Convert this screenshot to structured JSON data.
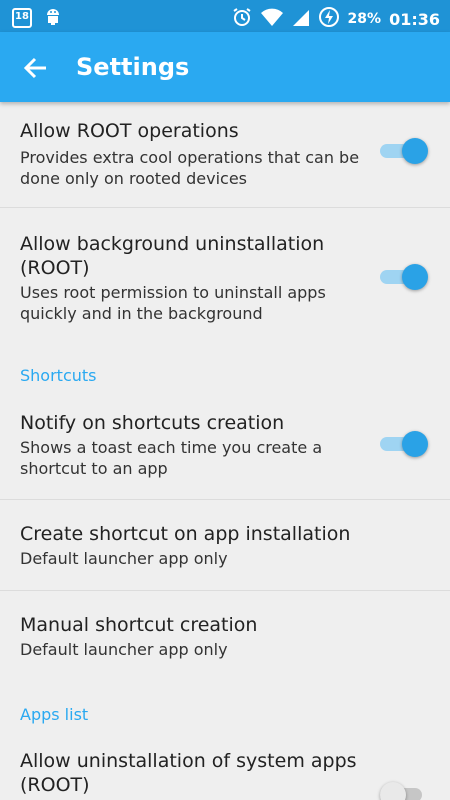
{
  "status_bar": {
    "date_badge": "18",
    "battery_percent": "28%",
    "time": "01:36",
    "icons": [
      "calendar-icon",
      "android-icon",
      "alarm-icon",
      "wifi-icon",
      "signal-icon",
      "battery-charging-icon"
    ]
  },
  "app_bar": {
    "title": "Settings",
    "back_icon": "arrow-left-icon",
    "color": "#2aa9f1"
  },
  "settings": [
    {
      "title": "Allow ROOT operations",
      "summary_lines": [
        "Provides extra cool operations that can be",
        "done only on rooted devices"
      ],
      "enabled": true
    },
    {
      "title_lines": [
        "Allow background uninstallation",
        "(ROOT)"
      ],
      "summary_lines": [
        "Uses root permission to uninstall apps",
        "quickly and in the background"
      ],
      "enabled": true
    }
  ],
  "sections": [
    {
      "header": "Shortcuts",
      "items": [
        {
          "title": "Notify on shortcuts creation",
          "summary_lines": [
            "Shows a toast each time you create a",
            "shortcut to an app"
          ],
          "enabled": true
        },
        {
          "title": "Create shortcut on app installation",
          "summary": "Default launcher app only"
        },
        {
          "title": "Manual shortcut creation",
          "summary": "Default launcher app only"
        }
      ]
    },
    {
      "header": "Apps list",
      "items": [
        {
          "title_lines": [
            "Allow uninstallation of system apps",
            "(ROOT)"
          ],
          "enabled": false
        }
      ]
    }
  ],
  "accent_color": "#2aa2e6"
}
